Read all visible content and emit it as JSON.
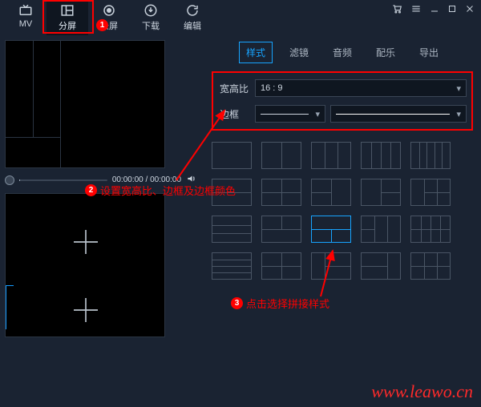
{
  "toolbar": {
    "items": [
      {
        "id": "mv",
        "label": "MV"
      },
      {
        "id": "split",
        "label": "分屏"
      },
      {
        "id": "record",
        "label": "录屏"
      },
      {
        "id": "download",
        "label": "下载"
      },
      {
        "id": "edit",
        "label": "编辑"
      }
    ],
    "active_index": 1
  },
  "player": {
    "time": "00:00:00 / 00:00:00"
  },
  "right_panel": {
    "tabs": [
      "样式",
      "滤镜",
      "音频",
      "配乐",
      "导出"
    ],
    "active_tab_index": 0,
    "settings": {
      "aspect_label": "宽高比",
      "aspect_value": "16 : 9",
      "border_label": "边框"
    }
  },
  "annotations": {
    "step1": "1",
    "step2": "2",
    "step2_text": "设置宽高比、边框及边框颜色",
    "step3": "3",
    "step3_text": "点击选择拼接样式"
  },
  "watermark": "www.leawo.cn"
}
